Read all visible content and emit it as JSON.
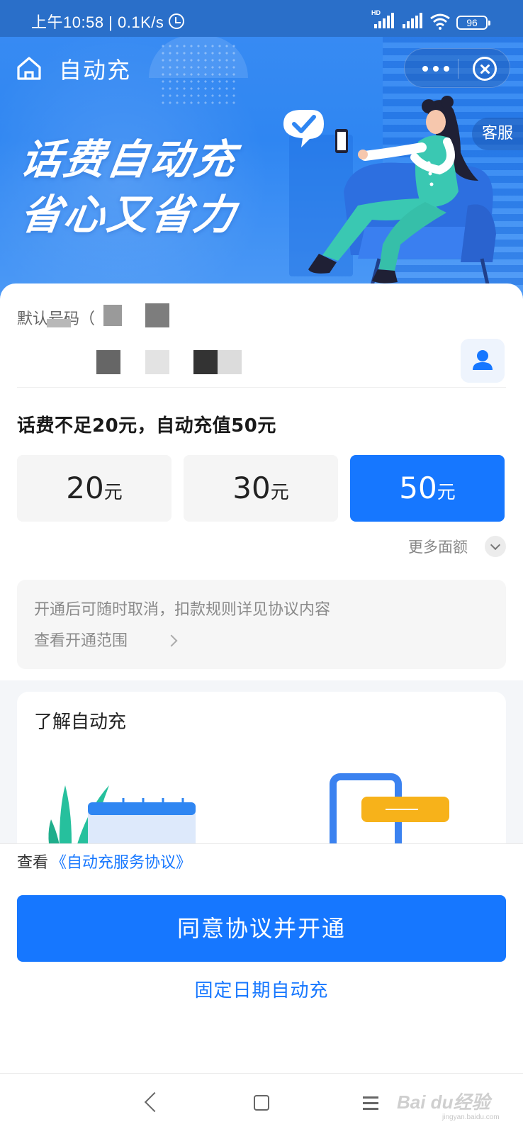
{
  "status_bar": {
    "time_speed": "上午10:58 | 0.1K/s",
    "network_label": "HD",
    "battery": "96"
  },
  "header": {
    "title": "自动充",
    "customer_service": "客服"
  },
  "banner": {
    "line1": "话费自动充",
    "line2": "省心又省力"
  },
  "number": {
    "label": "默认号码（"
  },
  "rule": {
    "title": "话费不足20元，自动充值50元"
  },
  "amounts": [
    {
      "value": "20",
      "unit": "元",
      "selected": false
    },
    {
      "value": "30",
      "unit": "元",
      "selected": false
    },
    {
      "value": "50",
      "unit": "元",
      "selected": true
    }
  ],
  "more_amounts": "更多面额",
  "notice": {
    "line1": "开通后可随时取消，扣款规则详见协议内容",
    "line2": "查看开通范围"
  },
  "learn": {
    "title": "了解自动充"
  },
  "agreement": {
    "prefix": "查看",
    "link": "《自动充服务协议》"
  },
  "actions": {
    "primary": "同意协议并开通",
    "secondary": "固定日期自动充"
  },
  "watermark": {
    "text": "Bai du经验",
    "sub": "jingyan.baidu.com"
  },
  "colors": {
    "accent": "#1677ff",
    "header_blue": "#2f86f2"
  }
}
